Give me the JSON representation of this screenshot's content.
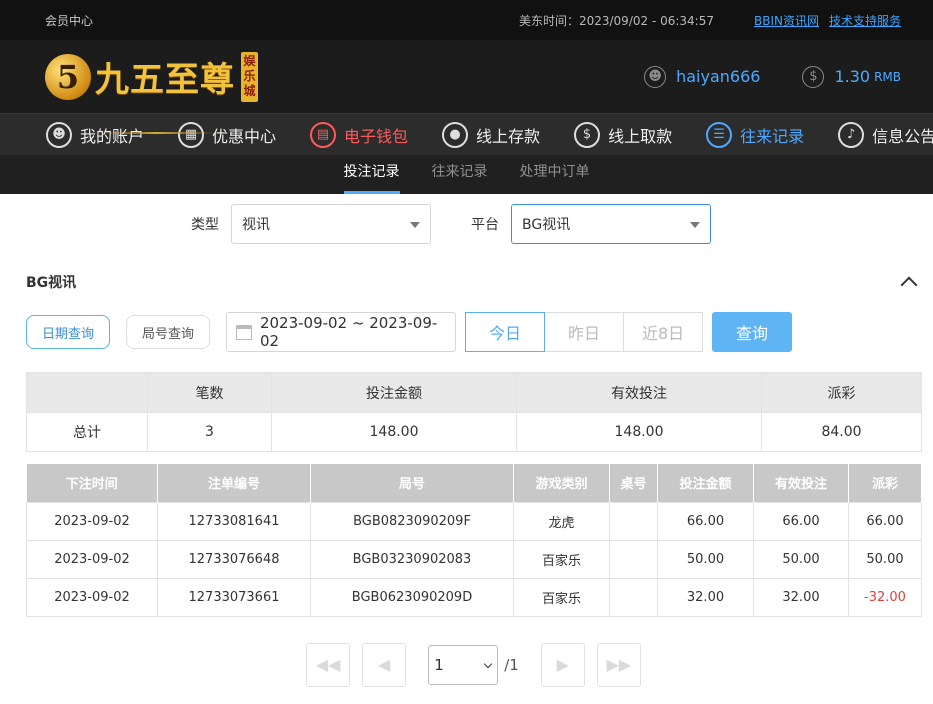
{
  "topbar": {
    "title": "会员中心",
    "time": "美东时间：2023/09/02 - 06:34:57",
    "link1": "BBIN资讯网",
    "link2": "技术支持服务"
  },
  "header": {
    "logo_mark": "5",
    "logo_text": "九五至尊",
    "logo_stamp": "娱乐城",
    "username": "haiyan666",
    "balance": "1.30",
    "currency": "RMB"
  },
  "nav": [
    {
      "label": "我的账户",
      "icon": "user-icon"
    },
    {
      "label": "优惠中心",
      "icon": "gift-icon"
    },
    {
      "label": "电子钱包",
      "icon": "wallet-icon"
    },
    {
      "label": "线上存款",
      "icon": "deposit-icon"
    },
    {
      "label": "线上取款",
      "icon": "withdraw-icon"
    },
    {
      "label": "往来记录",
      "icon": "records-icon"
    },
    {
      "label": "信息公告",
      "icon": "bell-icon"
    }
  ],
  "subnav": [
    "投注记录",
    "往来记录",
    "处理中订单"
  ],
  "filters": {
    "type_label": "类型",
    "type_value": "视讯",
    "platform_label": "平台",
    "platform_value": "BG视讯"
  },
  "section": {
    "title": "BG视讯"
  },
  "query": {
    "date_mode": "日期查询",
    "round_mode": "局号查询",
    "date_range": "2023-09-02 ~ 2023-09-02",
    "today": "今日",
    "yesterday": "昨日",
    "last8": "近8日",
    "search": "查询"
  },
  "summary": {
    "headers": [
      "",
      "笔数",
      "投注金额",
      "有效投注",
      "派彩"
    ],
    "row": [
      "总计",
      "3",
      "148.00",
      "148.00",
      "84.00"
    ]
  },
  "details": {
    "headers": [
      "下注时间",
      "注单编号",
      "局号",
      "游戏类别",
      "桌号",
      "投注金额",
      "有效投注",
      "派彩"
    ],
    "rows": [
      [
        "2023-09-02",
        "12733081641",
        "BGB0823090209F",
        "龙虎",
        "",
        "66.00",
        "66.00",
        "66.00"
      ],
      [
        "2023-09-02",
        "12733076648",
        "BGB03230902083",
        "百家乐",
        "",
        "50.00",
        "50.00",
        "50.00"
      ],
      [
        "2023-09-02",
        "12733073661",
        "BGB0623090209D",
        "百家乐",
        "",
        "32.00",
        "32.00",
        "-32.00"
      ]
    ]
  },
  "pager": {
    "page": "1",
    "total": "/1"
  }
}
